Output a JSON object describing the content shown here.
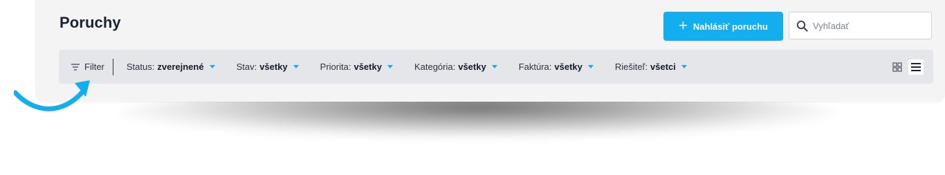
{
  "header": {
    "title": "Poruchy",
    "report_button_label": "Nahlásiť poruchu",
    "report_button_icon": "plus-icon",
    "search": {
      "placeholder": "Vyhľadať",
      "value": "",
      "icon": "search-icon"
    }
  },
  "filter_bar": {
    "toggle_label": "Filter",
    "toggle_icon": "filter-icon",
    "filters": [
      {
        "label": "Status:",
        "value": "zverejnené"
      },
      {
        "label": "Stav:",
        "value": "všetky"
      },
      {
        "label": "Priorita:",
        "value": "všetky"
      },
      {
        "label": "Kategória:",
        "value": "všetky"
      },
      {
        "label": "Faktúra:",
        "value": "všetky"
      },
      {
        "label": "Riešiteľ:",
        "value": "všetci"
      }
    ],
    "view_modes": [
      {
        "icon": "grid-view-icon",
        "active": false
      },
      {
        "icon": "list-view-icon",
        "active": true
      }
    ]
  },
  "colors": {
    "accent": "#12aef0",
    "card_background": "#f4f4f5",
    "filter_bar_background": "#e4e6ea",
    "title": "#1a2333"
  }
}
